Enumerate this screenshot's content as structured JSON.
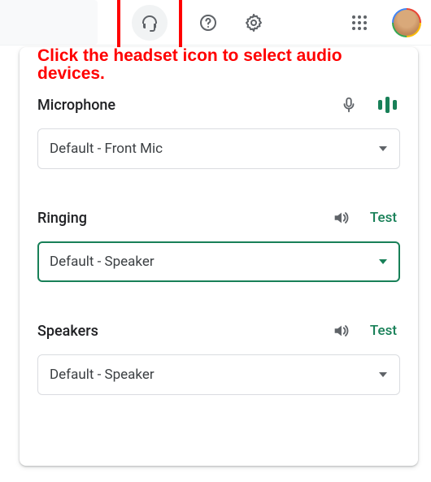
{
  "annotation": "Click the headset icon to select audio devices.",
  "sections": {
    "microphone": {
      "title": "Microphone",
      "value": "Default - Front Mic"
    },
    "ringing": {
      "title": "Ringing",
      "test": "Test",
      "value": "Default - Speaker"
    },
    "speakers": {
      "title": "Speakers",
      "test": "Test",
      "value": "Default - Speaker"
    }
  }
}
